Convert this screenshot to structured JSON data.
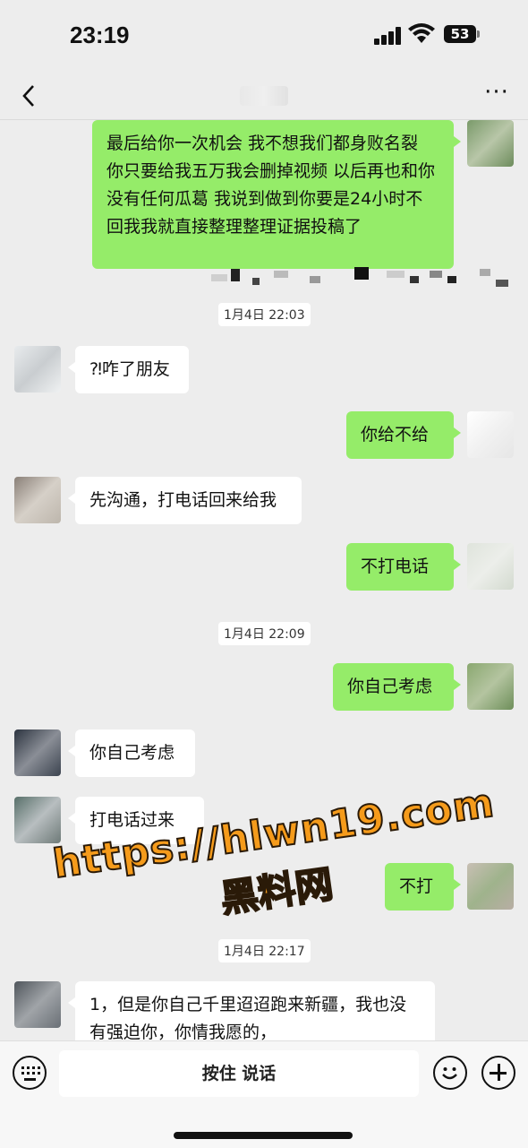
{
  "status_bar": {
    "time": "23:19",
    "battery": "53"
  },
  "nav": {
    "back_icon": "chevron-left-icon",
    "more_icon": "more-dots-icon",
    "more_label": "···"
  },
  "messages": [
    {
      "side": "sent",
      "text": "最后给你一次机会 我不想我们都身败名裂 你只要给我五万我会删掉视频 以后再也和你没有任何瓜葛 我说到做到你要是24小时不回我我就直接整理整理证据投稿了"
    },
    {
      "side": "timestamp",
      "text": "1月4日 22:03"
    },
    {
      "side": "recv",
      "text": "⁈咋了朋友"
    },
    {
      "side": "sent",
      "text": "你给不给"
    },
    {
      "side": "recv",
      "text": "先沟通，打电话回来给我"
    },
    {
      "side": "sent",
      "text": "不打电话"
    },
    {
      "side": "timestamp",
      "text": "1月4日 22:09"
    },
    {
      "side": "sent",
      "text": "你自己考虑"
    },
    {
      "side": "recv",
      "text": "你自己考虑"
    },
    {
      "side": "recv",
      "text": "打电话过来"
    },
    {
      "side": "sent",
      "text": "不打"
    },
    {
      "side": "timestamp",
      "text": "1月4日 22:17"
    },
    {
      "side": "recv",
      "text": "1，但是你自己千里迢迢跑来新疆，我也没有强迫你，你情我愿的，"
    }
  ],
  "watermark": {
    "url": "https://hlwn19.com",
    "name": "黑料网"
  },
  "input_bar": {
    "hold_to_talk": "按住 说话",
    "keyboard_icon": "keyboard-icon",
    "emoji_icon": "emoji-icon",
    "plus_icon": "plus-icon"
  },
  "colors": {
    "sent_bubble": "#95ec69",
    "recv_bubble": "#ffffff",
    "background": "#ededed",
    "watermark": "#f59b1b"
  }
}
